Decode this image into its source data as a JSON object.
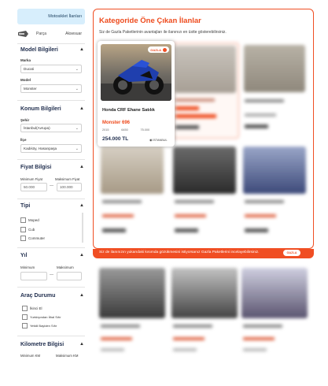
{
  "sidebar": {
    "tab_active": "Motosiklet İlanları",
    "tab_parca": "Parça",
    "tab_aksesuar": "Aksesuar",
    "model_title": "Model Bilgileri",
    "marka_label": "Marka",
    "marka_value": "Ducati",
    "model_label": "Model",
    "model_value": "Monster",
    "konum_title": "Konum Bilgileri",
    "sehir_label": "Şehir",
    "sehir_value": "İstanbul(Avrupa)",
    "ilce_label": "İlçe",
    "ilce_value": "Kadıköy, Hasanpaşa",
    "fiyat_title": "Fiyat Bilgisi",
    "min_fiyat_label": "Minimum Fiyat",
    "max_fiyat_label": "Maksimum Fiyat",
    "min_fiyat_value": "50.000",
    "max_fiyat_value": "100.000",
    "dash": "—",
    "tip_title": "Tipi",
    "tip_options": [
      "Moped",
      "Cub",
      "Commuter"
    ],
    "yil_title": "Yıl",
    "yil_min_label": "Minimum",
    "yil_max_label": "Maksimum",
    "arac_title": "Araç Durumu",
    "arac_options": [
      "İkinci El",
      "Yurtdışından İthal Sıfır",
      "Yetkili Bayiden Sıfır"
    ],
    "km_title": "Kilometre Bilgisi",
    "km_min_label": "Minimum KM",
    "km_max_label": "Maksimum KM"
  },
  "featured": {
    "title": "Kategoride Öne Çıkan İlanlar",
    "subtitle": "Siz de Gazla Paketlerinin avantajları ile ilanınızı en üstte gösterebilirsiniz.",
    "badge": "GAZLA",
    "card": {
      "name": "Honda CRF Ehane Satılık",
      "model": "Monster 696",
      "year": "2015",
      "km": "6450",
      "cc": "75.000",
      "price": "254.000 TL",
      "location": "İSTANBUL"
    },
    "info_text": "Siz de ilanınızın yukarıdaki kısımda gözükmesini istiyorsanız Gazla Paketlerini incelayebilirsiniz.",
    "info_pill": "GAZLA"
  },
  "colors": {
    "accent": "#f04e23",
    "sidebar_tab": "#d7eefc",
    "heading": "#1f2d4d"
  }
}
